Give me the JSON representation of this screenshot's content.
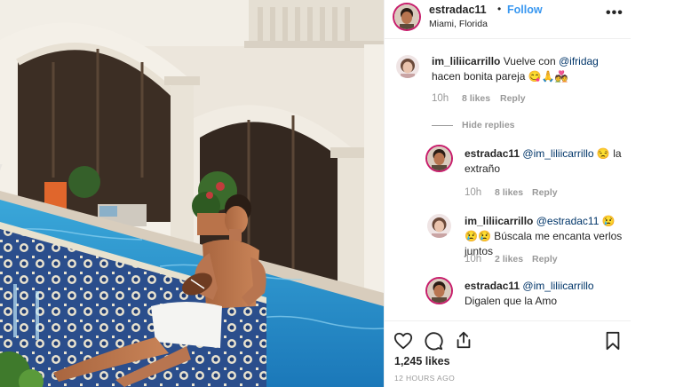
{
  "post": {
    "username": "estradac11",
    "separator": "•",
    "follow_label": "Follow",
    "location": "Miami, Florida",
    "more_label": "•••"
  },
  "comments": [
    {
      "username": "im_liliicarrillo",
      "text_before": " Vuelve con ",
      "mention": "@ifridag",
      "text_after": " hacen bonita pareja 😋🙏💑",
      "time": "10h",
      "likes": "8 likes",
      "reply": "Reply"
    }
  ],
  "hide_replies": "Hide replies",
  "replies": [
    {
      "username": "estradac11",
      "mention": "@im_liliicarrillo",
      "text_after": " 😒 la extraño",
      "time": "10h",
      "likes": "8 likes",
      "reply": "Reply"
    },
    {
      "username": "im_liliicarrillo",
      "mention": "@estradac11",
      "text_after": " 😢😢😢 Búscala me encanta verlos juntos",
      "time": "10h",
      "likes": "2 likes",
      "reply": "Reply"
    },
    {
      "username": "estradac11",
      "mention": "@im_liliicarrillo",
      "text_after": " Digalen que la Amo"
    }
  ],
  "actions": {
    "icons": [
      "heart-icon",
      "comment-icon",
      "share-icon",
      "bookmark-icon"
    ]
  },
  "likes_count": "1,245 likes",
  "timestamp": "12 HOURS AGO",
  "colors": {
    "follow": "#3897f0",
    "mention": "#003569",
    "muted": "#999999",
    "story_ring": "#c71d6b"
  }
}
